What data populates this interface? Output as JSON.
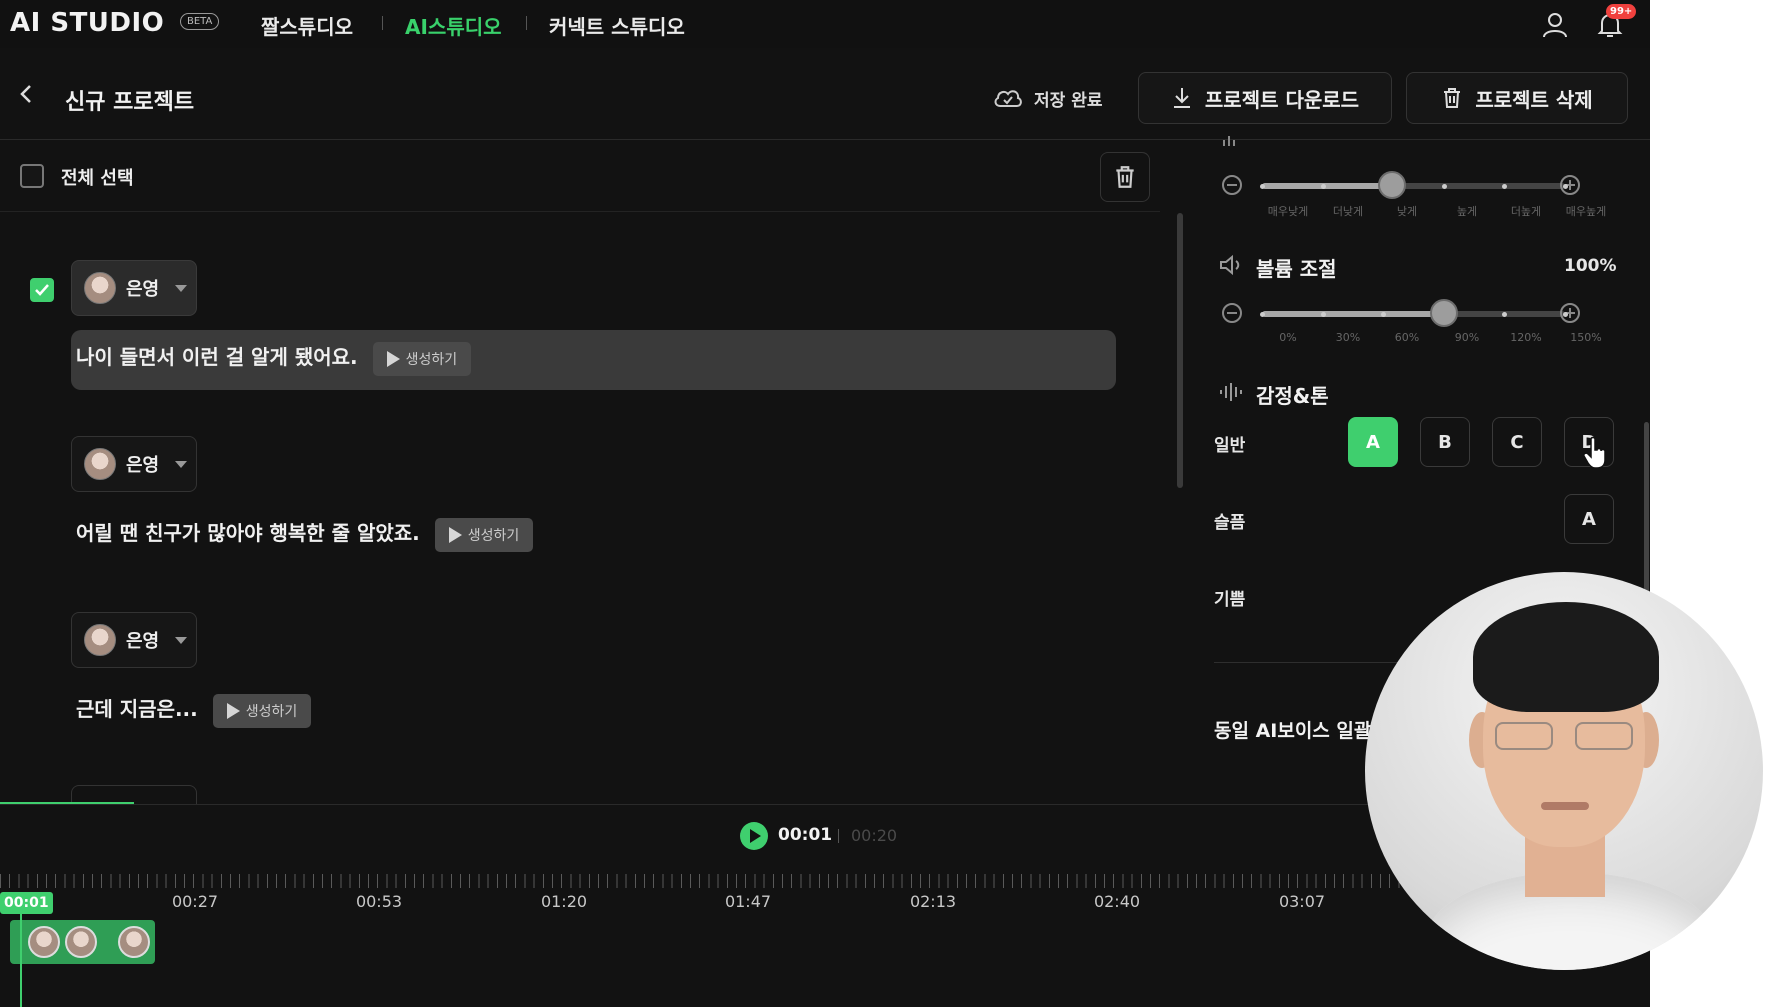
{
  "nav": {
    "logo": "AI STUDIO",
    "beta": "BETA",
    "links": [
      "짤스튜디오",
      "AI스튜디오",
      "커넥트 스튜디오"
    ],
    "active_link": "AI스튜디오",
    "notification_badge": "99+"
  },
  "header": {
    "title": "신규 프로젝트",
    "save_status": "저장 완료",
    "download_label": "프로젝트 다운로드",
    "delete_label": "프로젝트 삭제"
  },
  "list": {
    "select_all_label": "전체 선택",
    "generate_label": "생성하기",
    "lines": [
      {
        "speaker": "은영",
        "text": "나이 들면서 이런 걸 알게 됐어요.",
        "checked": true
      },
      {
        "speaker": "은영",
        "text": "어릴 땐 친구가 많아야 행복한 줄 알았죠.",
        "checked": false
      },
      {
        "speaker": "은영",
        "text": "근데 지금은...",
        "checked": false
      }
    ]
  },
  "settings": {
    "pitch": {
      "ticks": [
        "매우낮게",
        "더낮게",
        "낮게",
        "높게",
        "더높게",
        "매우높게"
      ],
      "level_fraction": 0.43
    },
    "volume": {
      "title": "볼륨 조절",
      "value": "100%",
      "ticks": [
        "0%",
        "30%",
        "60%",
        "90%",
        "120%",
        "150%"
      ],
      "level_fraction": 0.6
    },
    "emotion": {
      "title": "감정&톤",
      "rows": [
        {
          "label": "일반",
          "options": [
            "A",
            "B",
            "C",
            "D"
          ],
          "selected": "A"
        },
        {
          "label": "슬픔",
          "options": [
            "A"
          ]
        },
        {
          "label": "기쁨",
          "options": []
        }
      ]
    },
    "same_voice_label": "동일 AI보이스 일괄"
  },
  "player": {
    "current_time": "00:01",
    "total_time": "00:20"
  },
  "timeline": {
    "playhead": "00:01",
    "marks": [
      "00:27",
      "00:53",
      "01:20",
      "01:47",
      "02:13",
      "02:40",
      "03:07"
    ]
  },
  "colors": {
    "accent": "#3fcf6e",
    "background": "#121212",
    "badge": "#f0413e"
  }
}
